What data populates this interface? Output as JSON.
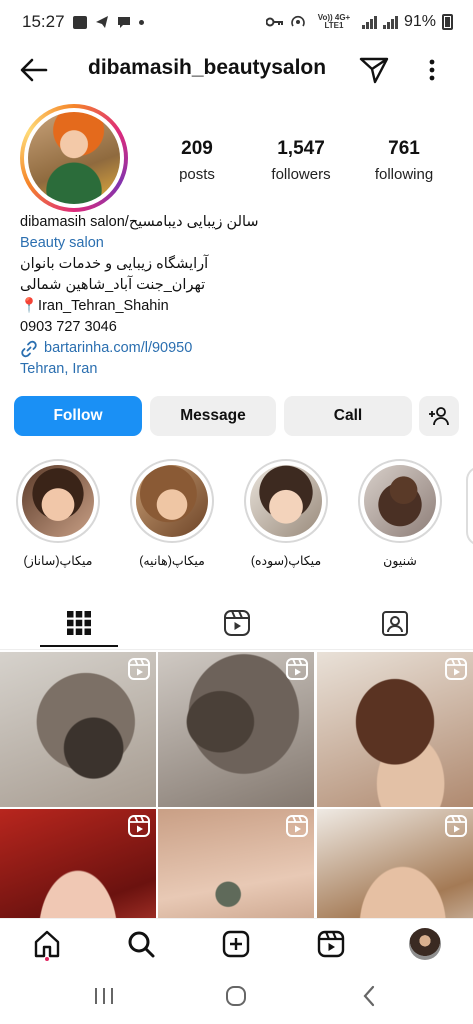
{
  "status_bar": {
    "time": "15:27",
    "battery": "91%",
    "network_label": "Vo)) 4G+ LTE1"
  },
  "header": {
    "username": "dibamasih_beautysalon"
  },
  "stats": {
    "posts": {
      "value": "209",
      "label": "posts"
    },
    "followers": {
      "value": "1,547",
      "label": "followers"
    },
    "following": {
      "value": "761",
      "label": "following"
    }
  },
  "bio": {
    "name": "سالن زیبایی دیبامسیح/dibamasih salon",
    "category": "Beauty salon",
    "line1": "آرایشگاه زیبایی و خدمات بانوان",
    "line2": "تهران_جنت آباد_شاهین شمالی",
    "line3": "📍Iran_Tehran_Shahin",
    "phone": "0903 727 3046",
    "link": "bartarinha.com/l/90950",
    "location": "Tehran, Iran"
  },
  "actions": {
    "follow": "Follow",
    "message": "Message",
    "call": "Call",
    "add_user_icon": "add-user-icon"
  },
  "highlights": [
    {
      "label": "میکاپ(ساناز)"
    },
    {
      "label": "میکاپ(هانیه)"
    },
    {
      "label": "میکاپ(سوده)"
    },
    {
      "label": "شنیون"
    }
  ],
  "tabs": [
    {
      "icon": "grid-icon",
      "active": true
    },
    {
      "icon": "reels-icon",
      "active": false
    },
    {
      "icon": "tagged-icon",
      "active": false
    }
  ],
  "colors": {
    "follow_button": "#1a90f5",
    "link_blue": "#2b6fb0",
    "grey_button": "#efefef"
  },
  "bottom_nav": [
    "home-icon",
    "search-icon",
    "create-icon",
    "reels-icon",
    "profile-avatar"
  ],
  "system_nav": [
    "recents-icon",
    "home-circle-icon",
    "back-chevron-icon"
  ]
}
